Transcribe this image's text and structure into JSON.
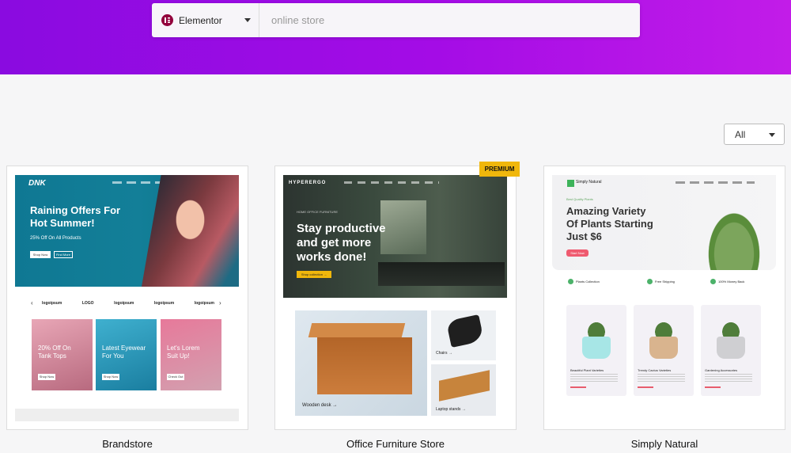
{
  "search": {
    "builder": "Elementor",
    "placeholder": "online store"
  },
  "filter": {
    "selected": "All"
  },
  "badge": "PREMIUM",
  "cards": [
    {
      "title": "Brandstore",
      "preview": {
        "logo": "DNK",
        "headline_1": "Raining Offers For",
        "headline_2": "Hot Summer!",
        "subtext": "25% Off On All Products",
        "btn_1": "Shop Now",
        "btn_2": "Find More",
        "logos": [
          "logoipsum",
          "LOGO",
          "logoipsum",
          "logoipsum",
          "logoipsum"
        ],
        "tiles": [
          {
            "line1": "20% Off On",
            "line2": "Tank Tops",
            "btn": "Shop Now"
          },
          {
            "line1": "Latest Eyewear",
            "line2": "For You",
            "btn": "Shop Now"
          },
          {
            "line1": "Let's Lorem",
            "line2": "Suit Up!",
            "btn": "Check Out"
          }
        ]
      }
    },
    {
      "title": "Office Furniture Store",
      "preview": {
        "logo": "HYPERERGO",
        "small": "HOME OFFICE FURNITURE",
        "headline_1": "Stay productive",
        "headline_2": "and get more",
        "headline_3": "works done!",
        "btn": "Shop collection →",
        "cap_desk": "Wooden desk →",
        "cap_chairs": "Chairs →",
        "cap_stands": "Laptop stands →"
      }
    },
    {
      "title": "Simply Natural",
      "preview": {
        "logo": "Simply Natural",
        "small": "Best Quality Plants",
        "headline_1": "Amazing Variety",
        "headline_2": "Of Plants Starting",
        "headline_3": "Just $6",
        "btn": "Start Now",
        "features": [
          "Plants Collection",
          "Free Shipping",
          "100% Money Back"
        ],
        "products": [
          "Beautiful Plant Varieties",
          "Trendy Cactus Varieties",
          "Gardening Accessories"
        ]
      }
    }
  ],
  "colors": {
    "hero_gradient_start": "#8a0be0",
    "hero_gradient_end": "#c21ce8",
    "badge": "#f0b70c",
    "elementor": "#92003b"
  }
}
